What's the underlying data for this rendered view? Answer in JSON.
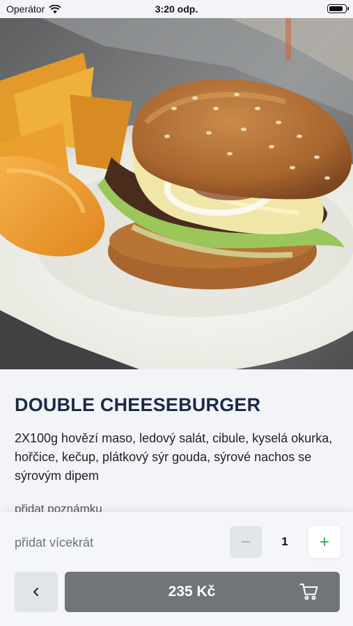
{
  "status_bar": {
    "carrier": "Operátor",
    "time": "3:20 odp.",
    "wifi_icon": "wifi-icon",
    "battery_icon": "battery-icon",
    "battery_level": 0.9
  },
  "hero": {
    "image": "burger-photo"
  },
  "product": {
    "title": "DOUBLE CHEESEBURGER",
    "description": "2X100g hovězí maso, ledový salát, cibule, kyselá okurka, hořčice, kečup, plátkový sýr gouda, sýrové nachos se sýrovým dipem",
    "note_placeholder": "přidat poznámku"
  },
  "order": {
    "repeat_label": "přidat vícekrát",
    "quantity": "1",
    "minus_icon": "minus-icon",
    "plus_icon": "plus-icon",
    "back_icon": "chevron-left-icon",
    "price": "235 Kč",
    "cart_icon": "cart-icon"
  },
  "colors": {
    "title": "#1c2a48",
    "plus": "#16a34a",
    "add_button": "#717478",
    "background": "#f3f4f8"
  }
}
